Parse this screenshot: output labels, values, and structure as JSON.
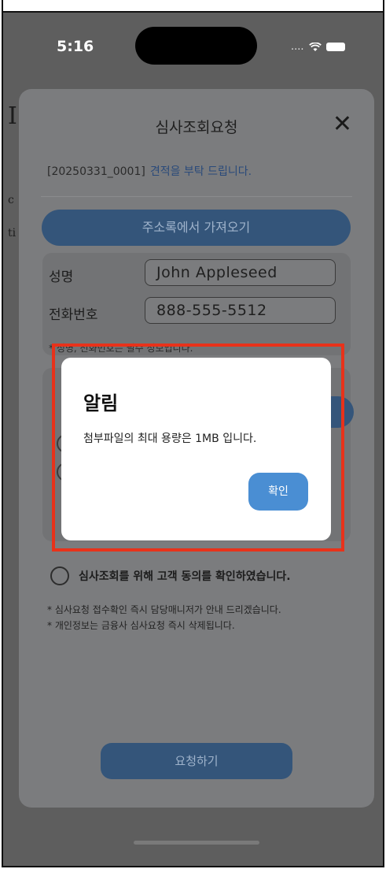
{
  "status_bar": {
    "time": "5:16",
    "signal": "....",
    "wifi_icon": "wifi-icon",
    "battery_icon": "battery-icon"
  },
  "background": {
    "heading_initial": "I",
    "side_letters": [
      "c",
      "ti"
    ]
  },
  "sheet": {
    "title": "심사조회요청",
    "close_icon": "close-icon",
    "ref_code": "[20250331_0001]",
    "ref_message": "견적을 부탁 드립니다.",
    "address_button": "주소록에서 가져오기",
    "form": {
      "name_label": "성명",
      "name_value": "John Appleseed",
      "phone_label": "전화번호",
      "phone_value": "888-555-5512",
      "note": "* 성명, 전화번호는 필수 정보입니다."
    },
    "consent_label": "심사조회를 위해 고객 동의를 확인하였습니다.",
    "notes": [
      "* 심사요청 접수확인 즉시 담당매니저가 안내 드리겠습니다.",
      "* 개인정보는 금융사 심사요청 즉시 삭제됩니다."
    ],
    "request_button": "요청하기"
  },
  "alert": {
    "title": "알림",
    "message": "첨부파일의 최대 용량은 1MB 입니다.",
    "confirm_button": "확인"
  },
  "colors": {
    "highlight": "#e8321a",
    "confirm_button": "#4a8ed3",
    "primary_button_dimmed": "#34557a"
  }
}
